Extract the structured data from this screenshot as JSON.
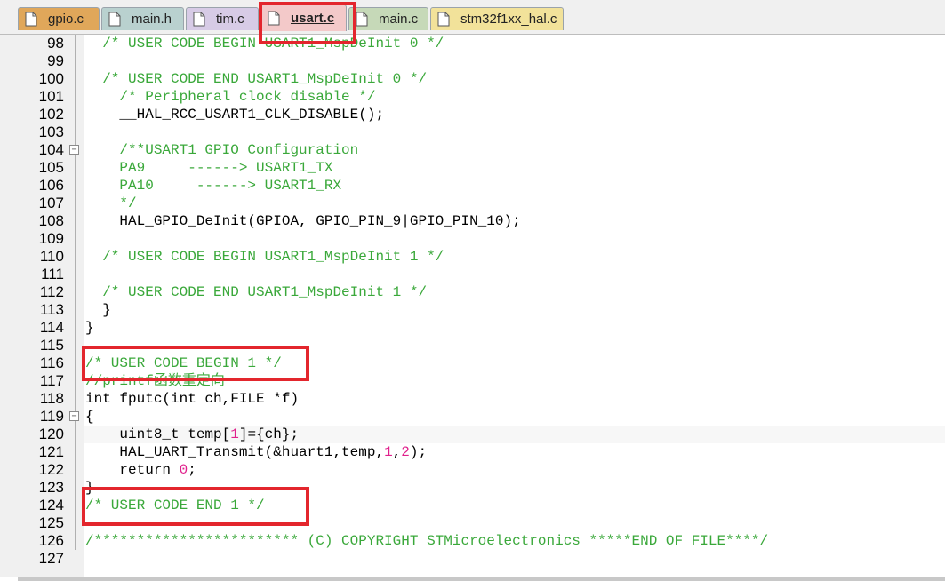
{
  "tabs": [
    {
      "label": "gpio.c",
      "color": "#e0a75a",
      "active": false
    },
    {
      "label": "main.h",
      "color": "#b9d1cf",
      "active": false
    },
    {
      "label": "tim.c",
      "color": "#d7cbe6",
      "active": false
    },
    {
      "label": "usart.c",
      "color": "#f3c9c9",
      "active": true
    },
    {
      "label": "main.c",
      "color": "#c6d9b8",
      "active": false
    },
    {
      "label": "stm32f1xx_hal.c",
      "color": "#f2e29a",
      "active": false
    }
  ],
  "lines": [
    {
      "n": "98",
      "fold": "",
      "parts": [
        {
          "t": "  /* USER CODE BEGIN USART1_MspDeInit 0 */",
          "c": "cmt"
        }
      ]
    },
    {
      "n": "99",
      "fold": "",
      "parts": []
    },
    {
      "n": "100",
      "fold": "",
      "parts": [
        {
          "t": "  /* USER CODE END USART1_MspDeInit 0 */",
          "c": "cmt"
        }
      ]
    },
    {
      "n": "101",
      "fold": "",
      "parts": [
        {
          "t": "    /* Peripheral clock disable */",
          "c": "cmt"
        }
      ]
    },
    {
      "n": "102",
      "fold": "",
      "parts": [
        {
          "t": "    __HAL_RCC_USART1_CLK_DISABLE();",
          "c": "plain"
        }
      ]
    },
    {
      "n": "103",
      "fold": "",
      "parts": []
    },
    {
      "n": "104",
      "fold": "−",
      "parts": [
        {
          "t": "    /**USART1 GPIO Configuration",
          "c": "cmt"
        }
      ]
    },
    {
      "n": "105",
      "fold": "",
      "parts": [
        {
          "t": "    PA9     ------> USART1_TX",
          "c": "cmt"
        }
      ]
    },
    {
      "n": "106",
      "fold": "",
      "parts": [
        {
          "t": "    PA10     ------> USART1_RX",
          "c": "cmt"
        }
      ]
    },
    {
      "n": "107",
      "fold": "",
      "parts": [
        {
          "t": "    */",
          "c": "cmt"
        }
      ]
    },
    {
      "n": "108",
      "fold": "",
      "parts": [
        {
          "t": "    HAL_GPIO_DeInit(GPIOA, GPIO_PIN_9|GPIO_PIN_10);",
          "c": "plain"
        }
      ]
    },
    {
      "n": "109",
      "fold": "",
      "parts": []
    },
    {
      "n": "110",
      "fold": "",
      "parts": [
        {
          "t": "  /* USER CODE BEGIN USART1_MspDeInit 1 */",
          "c": "cmt"
        }
      ]
    },
    {
      "n": "111",
      "fold": "",
      "parts": []
    },
    {
      "n": "112",
      "fold": "",
      "parts": [
        {
          "t": "  /* USER CODE END USART1_MspDeInit 1 */",
          "c": "cmt"
        }
      ]
    },
    {
      "n": "113",
      "fold": "",
      "parts": [
        {
          "t": "  }",
          "c": "plain"
        }
      ]
    },
    {
      "n": "114",
      "fold": "",
      "parts": [
        {
          "t": "}",
          "c": "plain"
        }
      ]
    },
    {
      "n": "115",
      "fold": "",
      "parts": []
    },
    {
      "n": "116",
      "fold": "",
      "parts": [
        {
          "t": "/* USER CODE BEGIN 1 */",
          "c": "cmt"
        }
      ]
    },
    {
      "n": "117",
      "fold": "",
      "parts": [
        {
          "t": "//printf函数重定向",
          "c": "cmt"
        }
      ]
    },
    {
      "n": "118",
      "fold": "",
      "parts": [
        {
          "t": "int fputc(int ch,FILE *f)",
          "c": "plain"
        }
      ]
    },
    {
      "n": "119",
      "fold": "−",
      "parts": [
        {
          "t": "{",
          "c": "plain"
        }
      ]
    },
    {
      "n": "120",
      "fold": "",
      "parts": [
        {
          "t": "    uint8_t temp[",
          "c": "plain"
        },
        {
          "t": "1",
          "c": "num"
        },
        {
          "t": "]={ch};",
          "c": "plain"
        }
      ]
    },
    {
      "n": "121",
      "fold": "",
      "parts": [
        {
          "t": "    HAL_UART_Transmit(&huart1,temp,",
          "c": "plain"
        },
        {
          "t": "1",
          "c": "num"
        },
        {
          "t": ",",
          "c": "plain"
        },
        {
          "t": "2",
          "c": "num"
        },
        {
          "t": ");",
          "c": "plain"
        }
      ]
    },
    {
      "n": "122",
      "fold": "",
      "parts": [
        {
          "t": "    return ",
          "c": "plain"
        },
        {
          "t": "0",
          "c": "num"
        },
        {
          "t": ";",
          "c": "plain"
        }
      ]
    },
    {
      "n": "123",
      "fold": "",
      "parts": [
        {
          "t": "}",
          "c": "plain"
        }
      ]
    },
    {
      "n": "124",
      "fold": "",
      "parts": [
        {
          "t": "/* USER CODE END 1 */",
          "c": "cmt"
        }
      ]
    },
    {
      "n": "125",
      "fold": "",
      "parts": []
    },
    {
      "n": "126",
      "fold": "",
      "parts": [
        {
          "t": "/************************ (C) COPYRIGHT STMicroelectronics *****END OF FILE****/",
          "c": "cmt"
        }
      ]
    },
    {
      "n": "127",
      "fold": "",
      "parts": []
    }
  ]
}
